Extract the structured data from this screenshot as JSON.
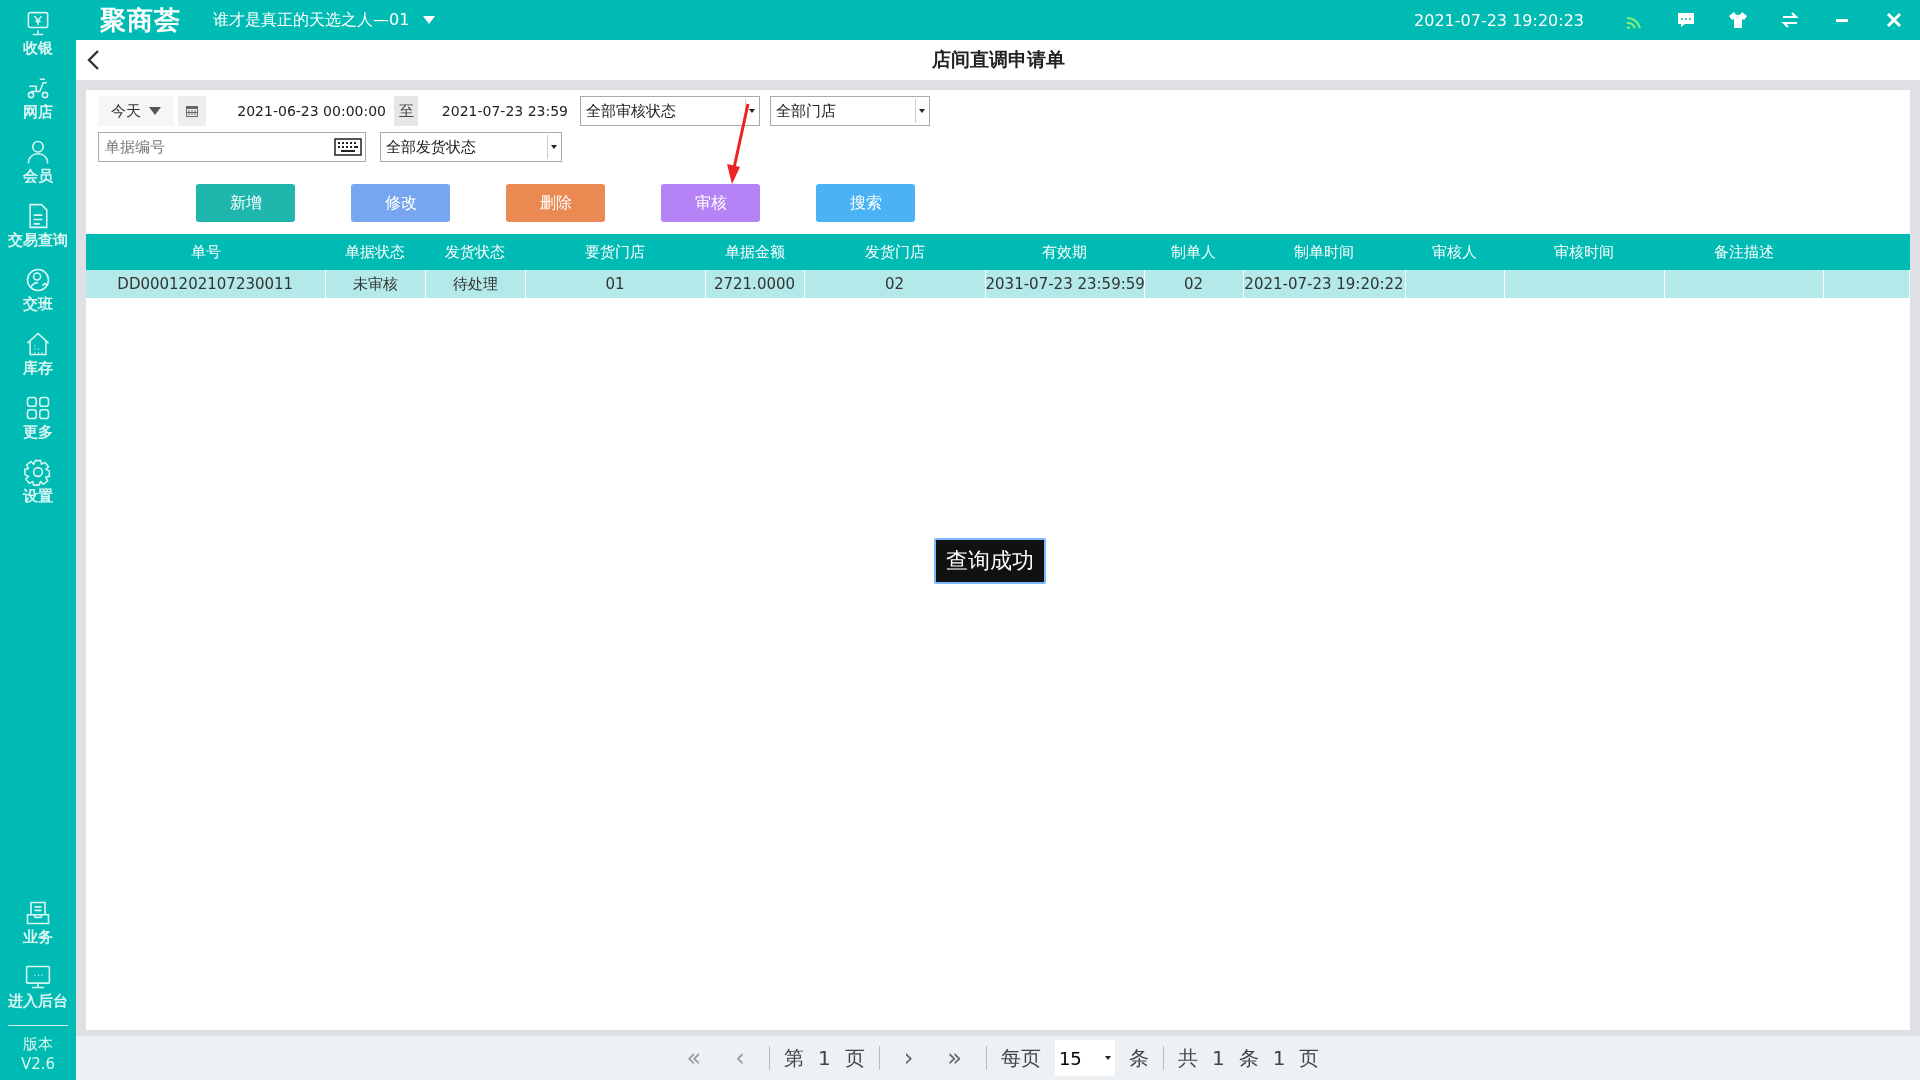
{
  "sidebar": {
    "items": [
      {
        "kind": "register",
        "label": "收银",
        "selected": false
      },
      {
        "kind": "scooter",
        "label": "网店",
        "selected": false
      },
      {
        "kind": "person",
        "label": "会员",
        "selected": false
      },
      {
        "kind": "document",
        "label": "交易查询",
        "selected": false
      },
      {
        "kind": "handover",
        "label": "交班",
        "selected": false
      },
      {
        "kind": "house",
        "label": "库存",
        "selected": false
      },
      {
        "kind": "grid",
        "label": "更多",
        "selected": false
      },
      {
        "kind": "gear",
        "label": "设置",
        "selected": false
      }
    ],
    "bottom_items": [
      {
        "kind": "tray",
        "label": "业务"
      },
      {
        "kind": "monitor",
        "label": "进入后台"
      }
    ],
    "version": [
      "版本",
      "V2.6"
    ]
  },
  "top_bar": {
    "logo": "聚商荟",
    "store": "谁才是真正的天选之人—01",
    "datetime": "2021-07-23 19:20:23"
  },
  "page": {
    "title": "店间直调申请单"
  },
  "filters": {
    "period": "今天",
    "date_from": "2021-06-23 00:00:00",
    "separator": "至",
    "date_to": "2021-07-23 23:59",
    "audit_status": "全部审核状态",
    "store": "全部门店",
    "order_no_placeholder": "单据编号",
    "ship_status": "全部发货状态"
  },
  "buttons": [
    {
      "label": "新增",
      "color": "#1fb6ae"
    },
    {
      "label": "修改",
      "color": "#78a5ef"
    },
    {
      "label": "删除",
      "color": "#ea8a52"
    },
    {
      "label": "审核",
      "color": "#b583f5"
    },
    {
      "label": "搜索",
      "color": "#4bb3f5"
    }
  ],
  "table": {
    "columns": [
      "单号",
      "单据状态",
      "发货状态",
      "要货门店",
      "单据金额",
      "发货门店",
      "有效期",
      "制单人",
      "制单时间",
      "审核人",
      "审核时间",
      "备注描述"
    ],
    "rows": [
      {
        "selected": true,
        "cells": [
          "DD0001202107230011",
          "未审核",
          "待处理",
          "01",
          "2721.0000",
          "02",
          "2031-07-23 23:59:59",
          "02",
          "2021-07-23 19:20:22",
          "",
          "",
          ""
        ]
      }
    ]
  },
  "toast": "查询成功",
  "pager": {
    "first": "«",
    "prev": "‹",
    "page_prefix": "第",
    "page": "1",
    "page_suffix": "页",
    "next": "›",
    "last": "»",
    "per_page_label": "每页",
    "per_page": "15",
    "per_page_unit": "条",
    "total_prefix": "共",
    "total": "1",
    "total_unit": "条",
    "pages": "1",
    "pages_unit": "页"
  }
}
